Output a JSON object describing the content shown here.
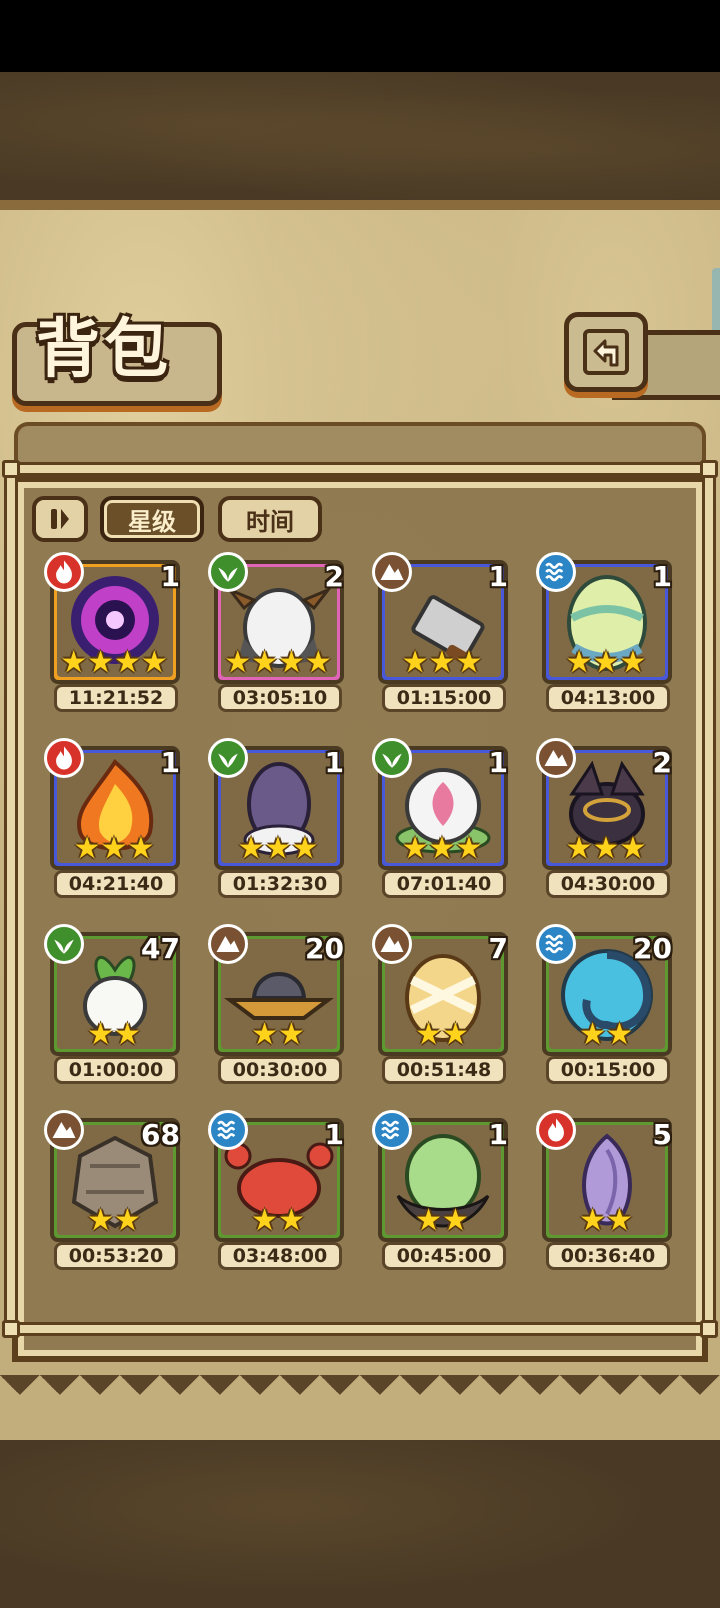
{
  "title": "背包",
  "filters": {
    "star_label": "星级",
    "time_label": "时间",
    "active": "star"
  },
  "colors": {
    "rarity5": "#f0a020",
    "rarity4": "#e064b8",
    "rarity3": "#4858d8",
    "rarity2": "#5e9830",
    "fire": "#d8332a",
    "grass": "#3f8f2c",
    "rock": "#7a5233",
    "water": "#2c86c6"
  },
  "items": [
    {
      "name": "dark-purple-orb",
      "element": "fire",
      "stars": 4,
      "count": "1",
      "timer": "11:21:52"
    },
    {
      "name": "horned-white-egg",
      "element": "grass",
      "stars": 4,
      "count": "2",
      "timer": "03:05:10"
    },
    {
      "name": "cleaver-knife",
      "element": "rock",
      "stars": 3,
      "count": "1",
      "timer": "01:15:00"
    },
    {
      "name": "striped-green-egg",
      "element": "water",
      "stars": 3,
      "count": "1",
      "timer": "04:13:00"
    },
    {
      "name": "flame-egg",
      "element": "fire",
      "stars": 3,
      "count": "1",
      "timer": "04:21:40"
    },
    {
      "name": "purple-furry-egg",
      "element": "grass",
      "stars": 3,
      "count": "1",
      "timer": "01:32:30"
    },
    {
      "name": "lotus-orb",
      "element": "grass",
      "stars": 3,
      "count": "1",
      "timer": "07:01:40"
    },
    {
      "name": "dark-bat-egg",
      "element": "rock",
      "stars": 3,
      "count": "2",
      "timer": "04:30:00"
    },
    {
      "name": "white-radish",
      "element": "grass",
      "stars": 2,
      "count": "47",
      "timer": "01:00:00"
    },
    {
      "name": "witch-hat",
      "element": "rock",
      "stars": 2,
      "count": "20",
      "timer": "00:30:00"
    },
    {
      "name": "bandaged-egg",
      "element": "rock",
      "stars": 2,
      "count": "7",
      "timer": "00:51:48"
    },
    {
      "name": "blue-shell-egg",
      "element": "water",
      "stars": 2,
      "count": "20",
      "timer": "00:15:00"
    },
    {
      "name": "stone-egg",
      "element": "rock",
      "stars": 2,
      "count": "68",
      "timer": "00:53:20"
    },
    {
      "name": "crab",
      "element": "water",
      "stars": 2,
      "count": "1",
      "timer": "03:48:00"
    },
    {
      "name": "cloaked-green-egg",
      "element": "water",
      "stars": 2,
      "count": "1",
      "timer": "00:45:00"
    },
    {
      "name": "violet-flower-bud",
      "element": "fire",
      "stars": 2,
      "count": "5",
      "timer": "00:36:40"
    }
  ]
}
